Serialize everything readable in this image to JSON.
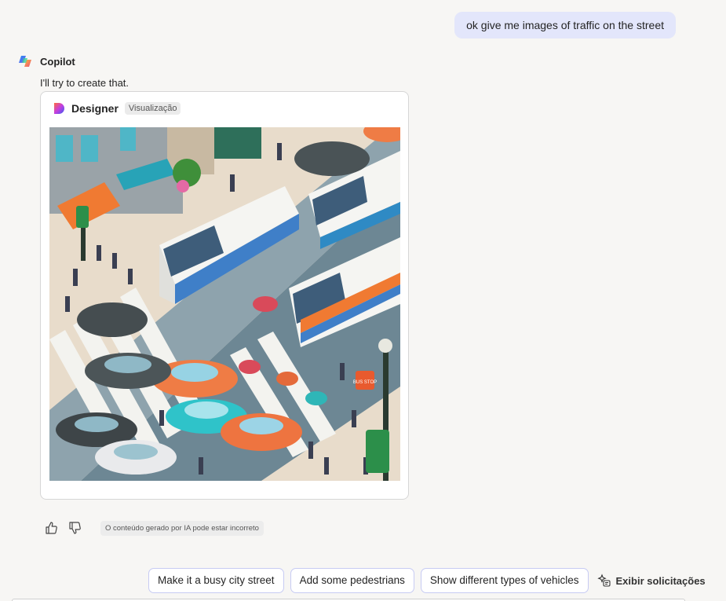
{
  "user_message": {
    "text": "ok give me images of traffic on the street"
  },
  "assistant": {
    "name": "Copilot",
    "logo_icon": "copilot-logo-icon",
    "text": "I'll try to create that."
  },
  "designer_card": {
    "title": "Designer",
    "badge": "Visualização",
    "logo_icon": "designer-logo-icon",
    "image_description_icon": "generated-image",
    "sign_text": "BUS STOP"
  },
  "feedback": {
    "thumbs_up_icon": "thumbs-up-icon",
    "thumbs_down_icon": "thumbs-down-icon",
    "disclaimer": "O conteúdo gerado por IA pode estar incorreto"
  },
  "suggestions": [
    {
      "label": "Make it a busy city street"
    },
    {
      "label": "Add some pedestrians"
    },
    {
      "label": "Show different types of vehicles"
    }
  ],
  "show_prompts": {
    "label": "Exibir solicitações",
    "icon": "sparkle-prompts-icon"
  },
  "colors": {
    "background": "#f7f6f4",
    "user_bubble": "#e3e6fb",
    "chip_border": "#c7cbf3"
  }
}
